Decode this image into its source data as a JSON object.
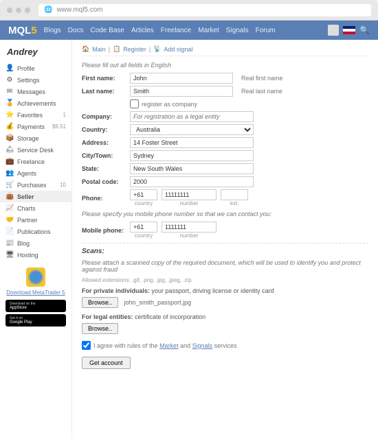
{
  "browser": {
    "url": "www.mql5.com"
  },
  "logo": {
    "text": "MQL",
    "suffix": "5"
  },
  "nav": [
    "Blogs",
    "Docs",
    "Code Base",
    "Articles",
    "Freelance",
    "Market",
    "Signals",
    "Forum"
  ],
  "user": {
    "name": "Andrey"
  },
  "sidebar": [
    {
      "icon": "👤",
      "label": "Profile"
    },
    {
      "icon": "⚙",
      "label": "Settings"
    },
    {
      "icon": "✉",
      "label": "Messages"
    },
    {
      "icon": "🏅",
      "label": "Achievements"
    },
    {
      "icon": "⭐",
      "label": "Favorites",
      "badge": "1"
    },
    {
      "icon": "💰",
      "label": "Payments",
      "badge": "$9.51"
    },
    {
      "icon": "📦",
      "label": "Storage"
    },
    {
      "icon": "🛎",
      "label": "Service Desk"
    },
    {
      "icon": "💼",
      "label": "Freelance"
    },
    {
      "icon": "👥",
      "label": "Agents"
    },
    {
      "icon": "🛒",
      "label": "Purchases",
      "badge": "10"
    },
    {
      "icon": "👜",
      "label": "Seller",
      "active": true
    },
    {
      "icon": "📈",
      "label": "Charts"
    },
    {
      "icon": "🤝",
      "label": "Partner"
    },
    {
      "icon": "📄",
      "label": "Publications"
    },
    {
      "icon": "📰",
      "label": "Blog"
    },
    {
      "icon": "🖥",
      "label": "Hosting"
    }
  ],
  "download": {
    "link": "Download MetaTrader 5",
    "appstore_small": "Download on the",
    "appstore": "AppStore",
    "gplay_small": "Get it on",
    "gplay": "Google Play"
  },
  "breadcrumb": {
    "main": "Main",
    "register": "Register",
    "add": "Add signal"
  },
  "form": {
    "note": "Please fill out all fields in English",
    "labels": {
      "first_name": "First name:",
      "last_name": "Last name:",
      "company": "Company:",
      "country": "Country:",
      "address": "Address:",
      "city": "City/Town:",
      "state": "State:",
      "postal": "Postal code:",
      "phone": "Phone:",
      "mobile": "Mobile phone:"
    },
    "values": {
      "first_name": "John",
      "last_name": "Smith",
      "company_placeholder": "For registration as a legal entity",
      "country": "Australia",
      "address": "14 Foster Street",
      "city": "Sydney",
      "state": "New South Wales",
      "postal": "2000",
      "phone_country": "+61",
      "phone_number": "11111111",
      "mobile_country": "+61",
      "mobile_number": "1111111"
    },
    "hints": {
      "first_name": "Real first name",
      "last_name": "Real last name"
    },
    "checkbox_company": "register as company",
    "sublabels": {
      "country": "country",
      "number": "number",
      "ext": "ext."
    },
    "mobile_note": "Please specify you mobile phone number so that we can contact you:"
  },
  "scans": {
    "title": "Scans:",
    "note": "Please attach a scanned copy of the required document, which will be used to identify you and protect against fraud",
    "ext_note": "Allowed extensions: .gif, .png, .jpg, .jpeg, .zip",
    "private_label": "For private individuals:",
    "private_text": "your passport, driving license or identity card",
    "legal_label": "For legal entities:",
    "legal_text": "certificate of incorporation",
    "browse": "Browse..",
    "uploaded": "john_smith_passport.jpg"
  },
  "agree": {
    "pre": "I agree with rules of the ",
    "market": "Market",
    "mid": " and ",
    "signals": "Signals",
    "post": " services"
  },
  "submit": "Get account"
}
